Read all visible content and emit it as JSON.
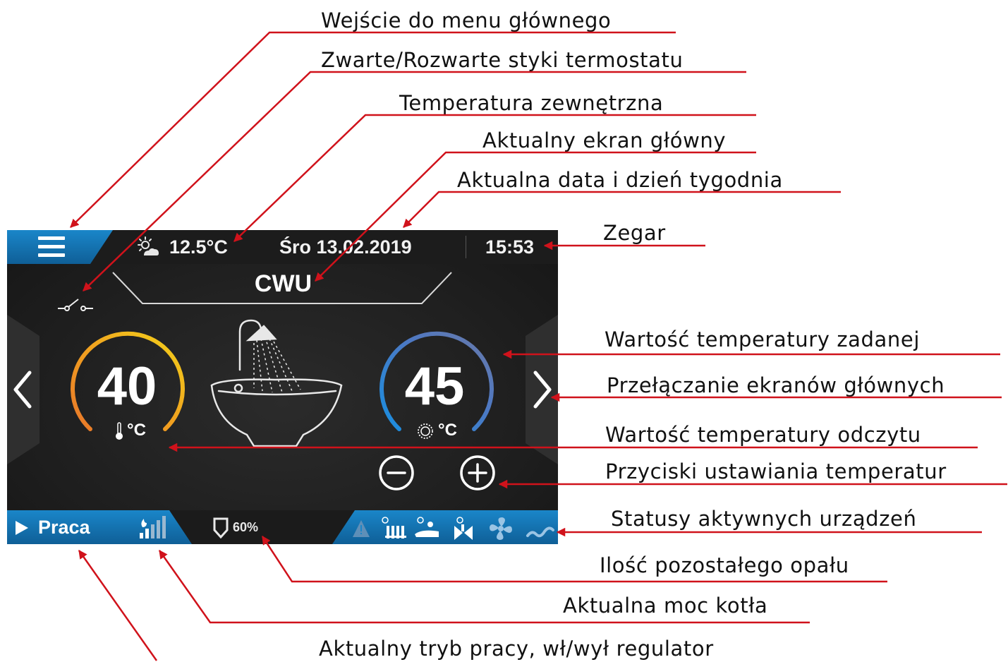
{
  "device": {
    "outdoor_temp": "12.5°C",
    "date": "Śro 13.02.2019",
    "clock": "15:53",
    "screen_title": "CWU",
    "read_temp": "40",
    "read_unit": "°C",
    "set_temp": "45",
    "set_unit": "°C",
    "mode": "Praca",
    "fuel_level": "60%",
    "accent_color": "#1a86c9"
  },
  "callouts": {
    "menu": "Wejście do menu głównego",
    "thermostat": "Zwarte/Rozwarte styki termostatu",
    "outdoor_temp": "Temperatura zewnętrzna",
    "current_screen": "Aktualny ekran główny",
    "date_day": "Aktualna data i dzień tygodnia",
    "clock": "Zegar",
    "set_temp": "Wartość temperatury zadanej",
    "switch_screens": "Przełączanie ekranów głównych",
    "read_temp": "Wartość temperatury odczytu",
    "temp_buttons": "Przyciski ustawiania temperatur",
    "device_status": "Statusy aktywnych urządzeń",
    "fuel": "Ilość pozostałego opału",
    "boiler_power": "Aktualna moc kotła",
    "work_mode": "Aktualny tryb pracy, wł/wył regulator"
  },
  "colors": {
    "annotation_line": "#d0121b",
    "gauge_read_start": "#e8772a",
    "gauge_read_end": "#f2d21b",
    "gauge_set_start": "#1a8ee0",
    "gauge_set_end": "#6a7aa8"
  }
}
